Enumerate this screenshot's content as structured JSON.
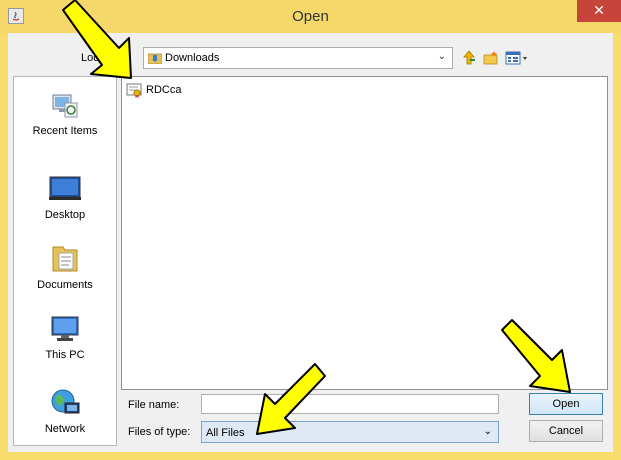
{
  "window": {
    "title": "Open",
    "close_glyph": "✕",
    "app_icon": "java-icon"
  },
  "lookin": {
    "label": "Look In:",
    "value": "Downloads",
    "icon": "downloads-folder-icon"
  },
  "toolbar": {
    "up_icon": "up-one-level-icon",
    "new_folder_icon": "create-new-folder-icon",
    "view_icon": "view-menu-icon"
  },
  "places": [
    {
      "label": "Recent Items",
      "icon": "recent-items-icon"
    },
    {
      "label": "Desktop",
      "icon": "desktop-icon"
    },
    {
      "label": "Documents",
      "icon": "documents-icon"
    },
    {
      "label": "This PC",
      "icon": "this-pc-icon"
    },
    {
      "label": "Network",
      "icon": "network-icon"
    }
  ],
  "files": [
    {
      "name": "RDCca",
      "icon": "certificate-file-icon"
    }
  ],
  "filename": {
    "label": "File name:",
    "value": ""
  },
  "filetype": {
    "label": "Files of type:",
    "value": "All Files"
  },
  "buttons": {
    "open": "Open",
    "cancel": "Cancel"
  },
  "colors": {
    "titlebar": "#f6d86a",
    "close": "#c7443b",
    "arrow_fill": "#ffff00",
    "arrow_stroke": "#000000"
  }
}
